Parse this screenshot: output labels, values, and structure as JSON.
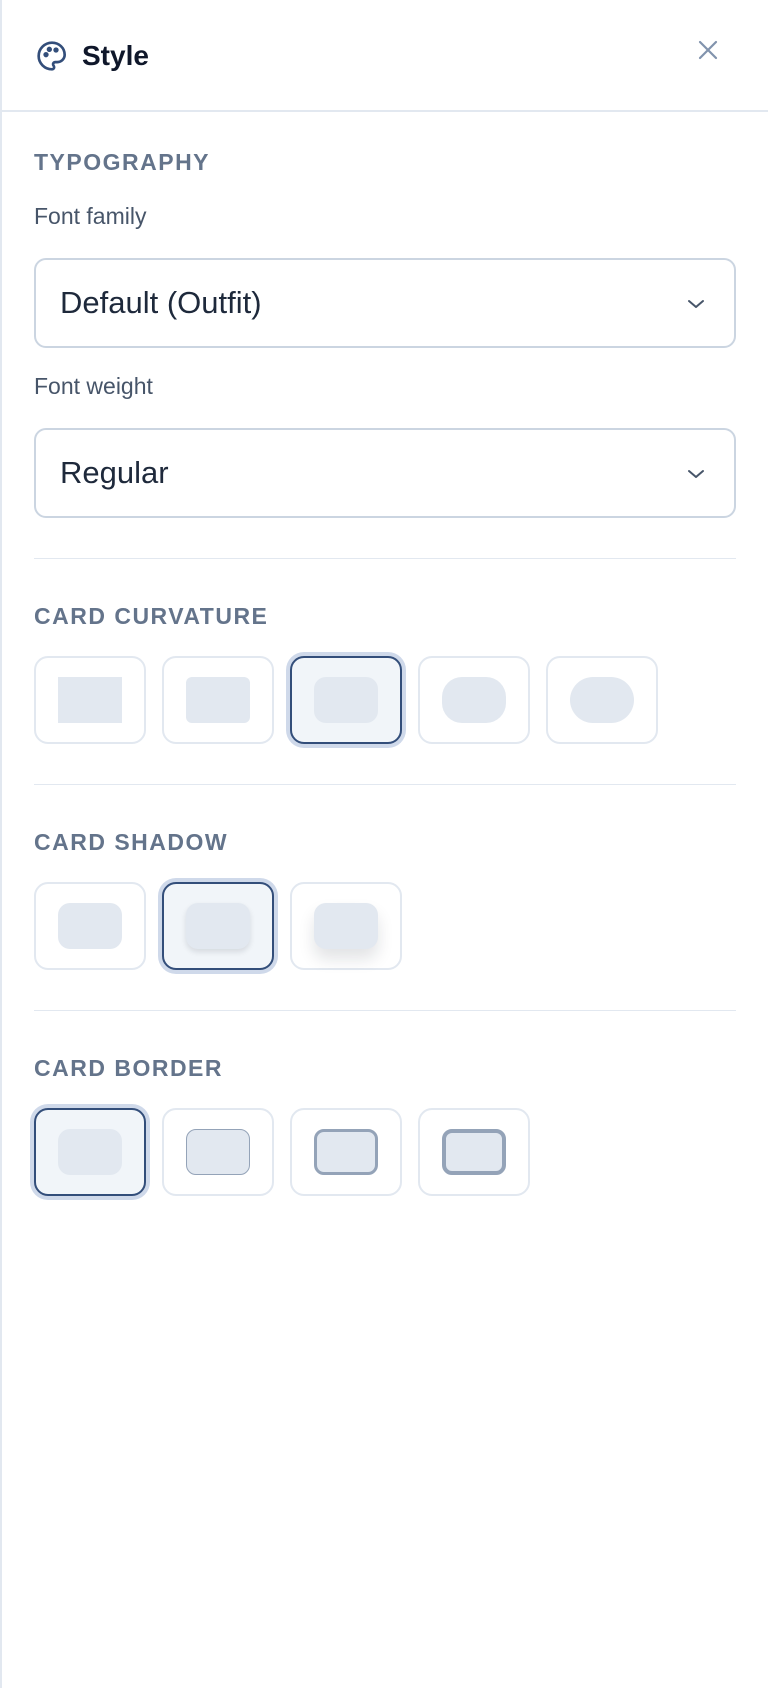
{
  "header": {
    "title": "Style",
    "icon": "palette-icon",
    "close_icon": "close-icon"
  },
  "typography": {
    "section_title": "TYPOGRAPHY",
    "font_family": {
      "label": "Font family",
      "value": "Default (Outfit)"
    },
    "font_weight": {
      "label": "Font weight",
      "value": "Regular"
    }
  },
  "card_curvature": {
    "section_title": "CARD CURVATURE",
    "options": [
      "none",
      "small",
      "medium",
      "large",
      "full"
    ],
    "selected": "medium"
  },
  "card_shadow": {
    "section_title": "CARD SHADOW",
    "options": [
      "none",
      "small",
      "large"
    ],
    "selected": "small"
  },
  "card_border": {
    "section_title": "CARD BORDER",
    "options": [
      "none",
      "thin",
      "medium",
      "thick"
    ],
    "selected": "none"
  },
  "colors": {
    "accent": "#334e7a",
    "muted_text": "#64748b",
    "border": "#e2e8f0",
    "swatch": "#e2e8f0"
  }
}
